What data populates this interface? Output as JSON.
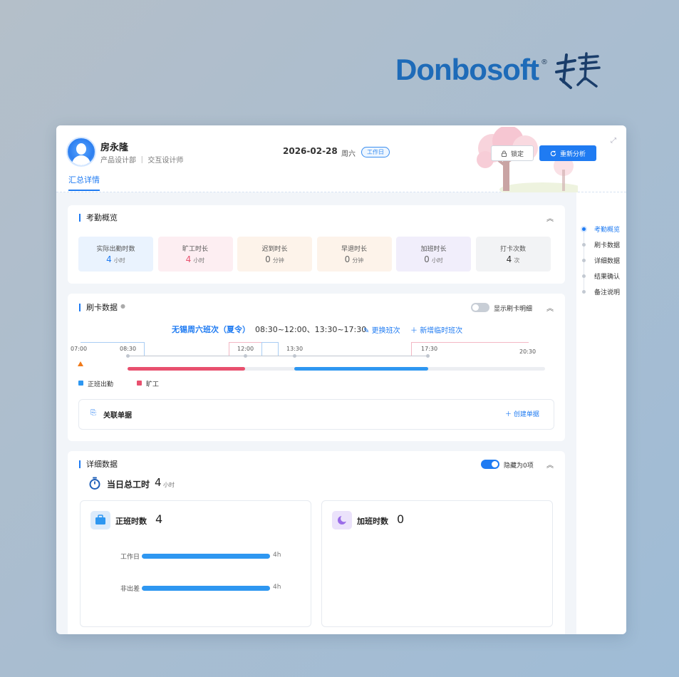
{
  "brand": {
    "name_en": "Donbosoft",
    "registered": "®"
  },
  "header": {
    "user_name": "房永隆",
    "department": "产品设计部 ｜ 交互设计师",
    "date": "2026-02-28",
    "weekday": "周六",
    "day_type": "工作日",
    "lock_label": "锁定",
    "reanalyze_label": "重新分析",
    "tab_summary": "汇总详情"
  },
  "right_nav": {
    "items": [
      "考勤概览",
      "刷卡数据",
      "详细数据",
      "结果确认",
      "备注说明"
    ],
    "active_index": 0
  },
  "overview": {
    "title": "考勤概览",
    "stats": [
      {
        "label": "实际出勤时数",
        "value": "4",
        "unit": "小时",
        "color": "#1f7bf2",
        "bg": "#eaf3fe"
      },
      {
        "label": "旷工时长",
        "value": "4",
        "unit": "小时",
        "color": "#e8506e",
        "bg": "#fdeef2"
      },
      {
        "label": "迟到时长",
        "value": "0",
        "unit": "分钟",
        "color": "#666666",
        "bg": "#fdf3ea"
      },
      {
        "label": "早退时长",
        "value": "0",
        "unit": "分钟",
        "color": "#666666",
        "bg": "#fdf3ea"
      },
      {
        "label": "加班时长",
        "value": "0",
        "unit": "小时",
        "color": "#666666",
        "bg": "#f1eefb"
      },
      {
        "label": "打卡次数",
        "value": "4",
        "unit": "次",
        "color": "#333333",
        "bg": "#f2f3f5"
      }
    ]
  },
  "punch": {
    "title": "刷卡数据",
    "show_detail_label": "显示刷卡明细",
    "show_detail_on": false,
    "shift_name": "无锡周六班次（夏令）",
    "shift_hours": "08:30~12:00、13:30~17:30",
    "change_shift_label": "更换班次",
    "add_temp_shift_label": "新增临时班次",
    "timeline_times": [
      "07:00",
      "08:30",
      "12:00",
      "13:30",
      "17:30",
      "20:30"
    ],
    "legend": [
      {
        "label": "正班出勤",
        "color": "#2e97f1"
      },
      {
        "label": "旷工",
        "color": "#e8506e"
      }
    ],
    "related_docs_label": "关联单据",
    "create_doc_label": "创建单据"
  },
  "detail": {
    "title": "详细数据",
    "hide_zero_label": "隐藏为0项",
    "hide_zero_on": true,
    "total_label": "当日总工时",
    "total_value": "4",
    "total_unit": "小时",
    "regular": {
      "title": "正班时数",
      "value": "4",
      "rows": [
        {
          "label": "工作日",
          "value": "4h",
          "fraction": 1.0
        },
        {
          "label": "非出差",
          "value": "4h",
          "fraction": 1.0
        }
      ]
    },
    "overtime": {
      "title": "加班时数",
      "value": "0"
    }
  }
}
